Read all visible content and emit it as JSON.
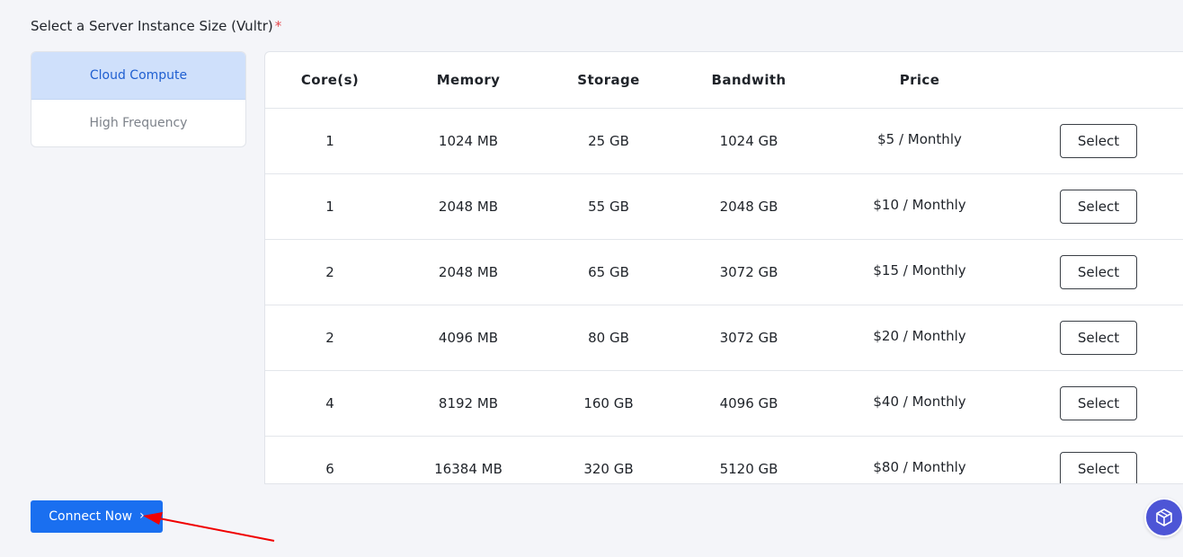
{
  "section": {
    "label": "Select a Server Instance Size (Vultr)",
    "required_mark": "*"
  },
  "tabs": [
    {
      "label": "Cloud Compute",
      "active": true
    },
    {
      "label": "High Frequency",
      "active": false
    }
  ],
  "table": {
    "headers": [
      "Core(s)",
      "Memory",
      "Storage",
      "Bandwith",
      "Price"
    ],
    "select_label": "Select",
    "rows": [
      {
        "cores": "1",
        "memory": "1024 MB",
        "storage": "25 GB",
        "bandwidth": "1024 GB",
        "price": "$5 / Monthly"
      },
      {
        "cores": "1",
        "memory": "2048 MB",
        "storage": "55 GB",
        "bandwidth": "2048 GB",
        "price": "$10 / Monthly"
      },
      {
        "cores": "2",
        "memory": "2048 MB",
        "storage": "65 GB",
        "bandwidth": "3072 GB",
        "price": "$15 / Monthly"
      },
      {
        "cores": "2",
        "memory": "4096 MB",
        "storage": "80 GB",
        "bandwidth": "3072 GB",
        "price": "$20 / Monthly"
      },
      {
        "cores": "4",
        "memory": "8192 MB",
        "storage": "160 GB",
        "bandwidth": "4096 GB",
        "price": "$40 / Monthly"
      },
      {
        "cores": "6",
        "memory": "16384 MB",
        "storage": "320 GB",
        "bandwidth": "5120 GB",
        "price": "$80 / Monthly"
      }
    ]
  },
  "connect_button": {
    "label": "Connect Now",
    "icon": "chevron-right-icon"
  },
  "widget": {
    "icon": "box-icon"
  },
  "colors": {
    "accent": "#1a6ff0",
    "active_tab_bg": "#cfe0fb",
    "active_tab_text": "#1f5fd1",
    "required": "#e5484d",
    "annotation_arrow": "#f00000",
    "widget": "#4d55d6"
  }
}
